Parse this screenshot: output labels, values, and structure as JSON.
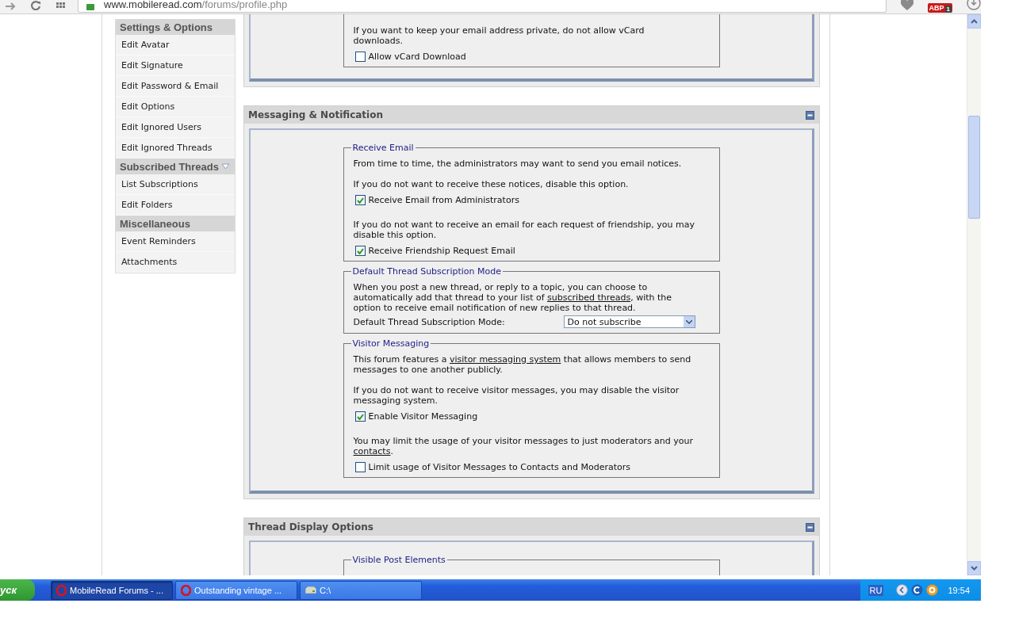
{
  "browser": {
    "url_host": "www.mobileread.com",
    "url_path": "/forums/profile.php",
    "abp_label": "ABP",
    "abp_count": "1"
  },
  "sidebar": [
    {
      "heading": "Settings & Options",
      "dropdown": false,
      "items": [
        "Edit Avatar",
        "Edit Signature",
        "Edit Password & Email",
        "Edit Options",
        "Edit Ignored Users",
        "Edit Ignored Threads"
      ]
    },
    {
      "heading": "Subscribed Threads",
      "dropdown": true,
      "items": [
        "List Subscriptions",
        "Edit Folders"
      ]
    },
    {
      "heading": "Miscellaneous",
      "dropdown": false,
      "items": [
        "Event Reminders",
        "Attachments"
      ]
    }
  ],
  "panels": [
    {
      "fieldsets": [
        {
          "blocks": [
            {
              "kind": "text",
              "parts": [
                {
                  "text": "If you want to keep your email address private, do not allow vCard downloads."
                }
              ]
            },
            {
              "kind": "checkbox",
              "label": "Allow vCard Download",
              "checked": false
            }
          ]
        }
      ]
    },
    {
      "title": "Messaging & Notification",
      "fieldsets": [
        {
          "legend": "Receive Email",
          "blocks": [
            {
              "kind": "text",
              "parts": [
                {
                  "text": "From time to time, the administrators may want to send you email notices."
                }
              ]
            },
            {
              "kind": "text",
              "parts": [
                {
                  "text": "If you do not want to receive these notices, disable this option."
                }
              ]
            },
            {
              "kind": "checkbox",
              "label": "Receive Email from Administrators",
              "checked": true
            },
            {
              "kind": "text",
              "parts": [
                {
                  "text": "If you do not want to receive an email for each request of friendship, you may disable this option."
                }
              ]
            },
            {
              "kind": "checkbox",
              "label": "Receive Friendship Request Email",
              "checked": true
            }
          ]
        },
        {
          "legend": "Default Thread Subscription Mode",
          "blocks": [
            {
              "kind": "text",
              "parts": [
                {
                  "text": "When you post a new thread, or reply to a topic, you can choose to automatically add that thread to your list of "
                },
                {
                  "text": "subscribed threads",
                  "kind": "link"
                },
                {
                  "text": ", with the option to receive email notification of new replies to that thread."
                }
              ]
            },
            {
              "kind": "select",
              "label": "Default Thread Subscription Mode:",
              "value": "Do not subscribe"
            }
          ]
        },
        {
          "legend": "Visitor Messaging",
          "blocks": [
            {
              "kind": "text",
              "parts": [
                {
                  "text": "This forum features a "
                },
                {
                  "text": "visitor messaging system",
                  "kind": "link"
                },
                {
                  "text": " that allows members to send messages to one another publicly."
                }
              ]
            },
            {
              "kind": "text",
              "parts": [
                {
                  "text": "If you do not want to receive visitor messages, you may disable the visitor messaging system."
                }
              ]
            },
            {
              "kind": "checkbox",
              "label": "Enable Visitor Messaging",
              "checked": true
            },
            {
              "kind": "text",
              "parts": [
                {
                  "text": "You may limit the usage of your visitor messages to just moderators and your "
                },
                {
                  "text": "contacts",
                  "kind": "link"
                },
                {
                  "text": "."
                }
              ]
            },
            {
              "kind": "checkbox",
              "label": "Limit usage of Visitor Messages to Contacts and Moderators",
              "checked": false
            }
          ]
        }
      ]
    },
    {
      "title": "Thread Display Options",
      "fieldsets": [
        {
          "legend": "Visible Post Elements"
        }
      ]
    }
  ],
  "taskbar": {
    "start": "уск",
    "tasks": [
      {
        "label": "MobileRead Forums - ...",
        "kind": "browser",
        "selected": true
      },
      {
        "label": "Outstanding vintage ...",
        "kind": "browser",
        "selected": false
      },
      {
        "label": "C:\\",
        "kind": "folder",
        "selected": false
      }
    ],
    "language": "RU",
    "time": "19:54"
  }
}
